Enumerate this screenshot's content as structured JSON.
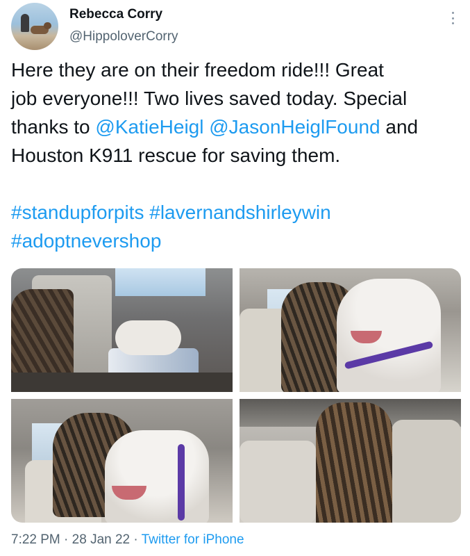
{
  "author": {
    "name": "Rebecca Corry",
    "handle": "@HippoloverCorry"
  },
  "tweet": {
    "line1": "Here they are on their freedom ride!!! Great",
    "line2": "job everyone!!! Two lives saved today. Special",
    "line3_prefix": "thanks to ",
    "mention1": "@KatieHeigl",
    "line3_space": " ",
    "mention2": "@JasonHeiglFound",
    "line3_suffix": " and",
    "line4": "Houston K911 rescue for saving them.",
    "hashtag1": "#standupforpits",
    "hashtag_space": " ",
    "hashtag2": "#lavernandshirleywin",
    "hashtag3": "#adoptnevershop"
  },
  "meta": {
    "time": "7:22 PM",
    "separator1": " · ",
    "date": "28 Jan 22",
    "separator2": " · ",
    "source": "Twitter for iPhone"
  },
  "icons": {
    "more": "more-vertical-icon"
  },
  "colors": {
    "link": "#1d9bf0",
    "secondary_text": "#536471",
    "primary_text": "#0f1419"
  }
}
